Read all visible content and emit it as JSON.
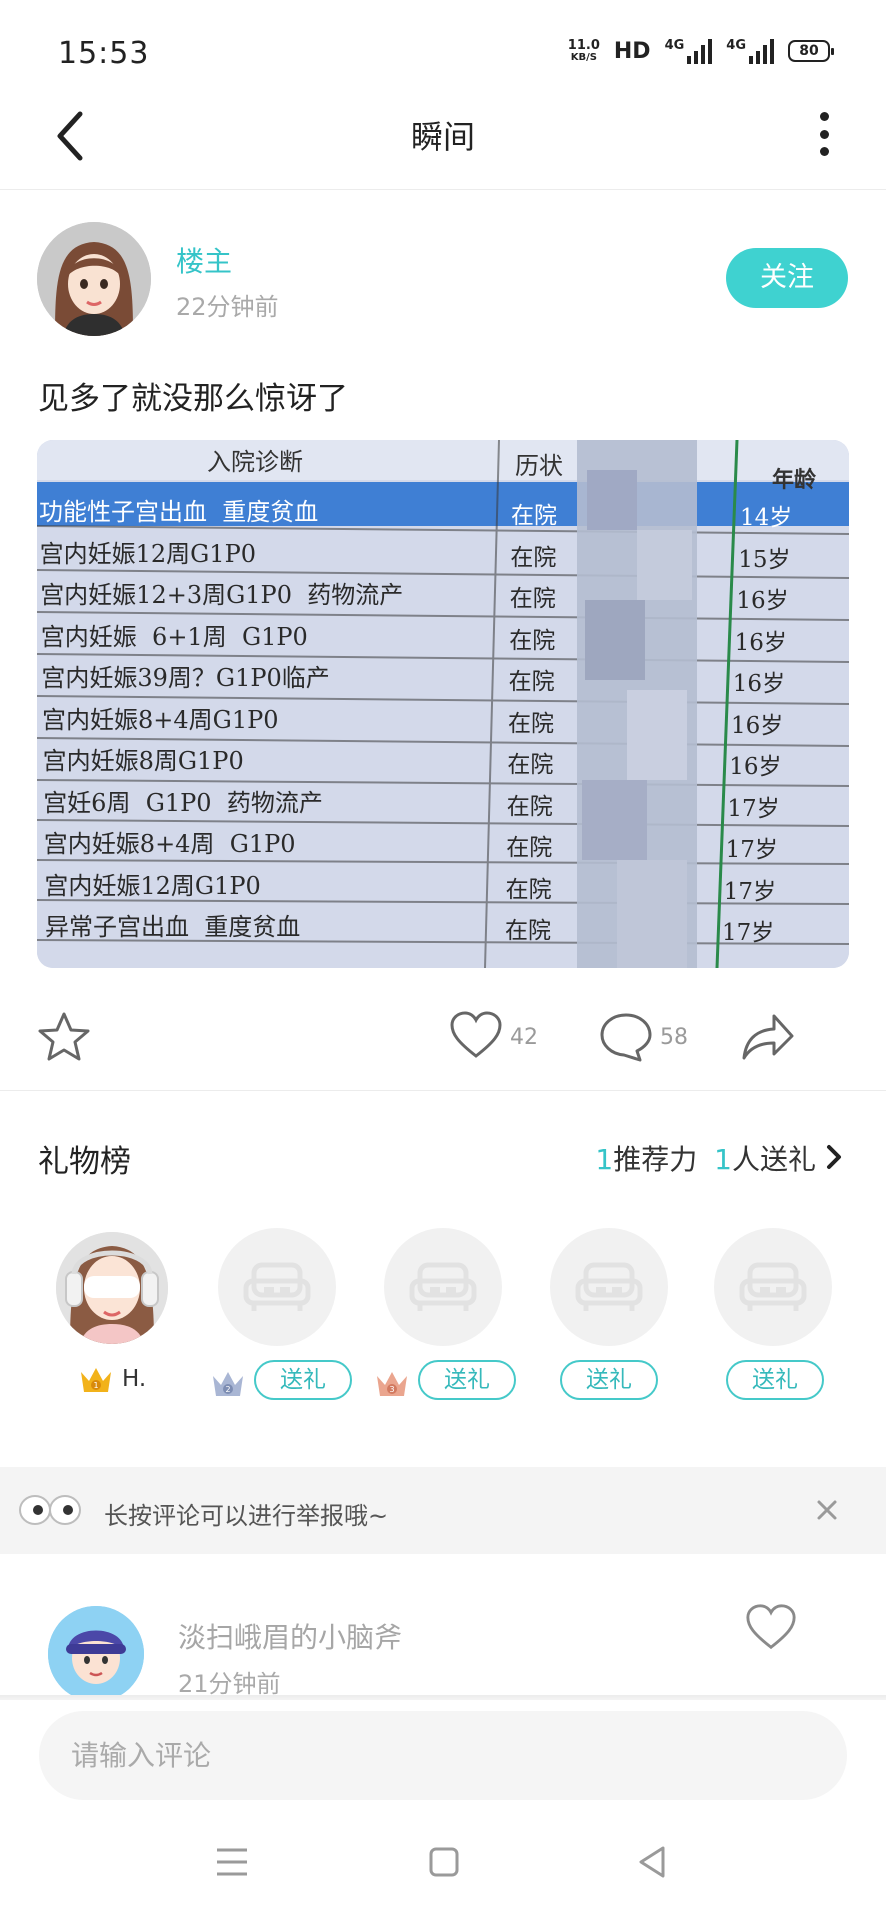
{
  "status_bar": {
    "time": "15:53",
    "speed_value": "11.0",
    "speed_unit": "KB/S",
    "hd_label": "HD",
    "sim1_label": "4G",
    "sim2_label": "4G",
    "battery": "80"
  },
  "header": {
    "title": "瞬间",
    "back_icon": "chevron-left-icon",
    "more_icon": "more-vertical-icon"
  },
  "post": {
    "author_name": "楼主",
    "post_time": "22分钟前",
    "follow_label": "关注",
    "text": "见多了就没那么惊讶了",
    "photo": {
      "headers": [
        "入院诊断",
        "历状",
        "年龄"
      ],
      "rows": [
        {
          "diagnosis": "功能性子宫出血  重度贫血",
          "status": "在院",
          "age": "14岁"
        },
        {
          "diagnosis": "宫内妊娠12周G1P0",
          "status": "在院",
          "age": "15岁"
        },
        {
          "diagnosis": "宫内妊娠12+3周G1P0  药物流产",
          "status": "在院",
          "age": "16岁"
        },
        {
          "diagnosis": "宫内妊娠  6+1周  G1P0",
          "status": "在院",
          "age": "16岁"
        },
        {
          "diagnosis": "宫内妊娠39周？G1P0临产",
          "status": "在院",
          "age": "16岁"
        },
        {
          "diagnosis": "宫内妊娠8+4周G1P0",
          "status": "在院",
          "age": "16岁"
        },
        {
          "diagnosis": "宫内妊娠8周G1P0",
          "status": "在院",
          "age": "16岁"
        },
        {
          "diagnosis": "宫妊6周  G1P0  药物流产",
          "status": "在院",
          "age": "17岁"
        },
        {
          "diagnosis": "宫内妊娠8+4周  G1P0",
          "status": "在院",
          "age": "17岁"
        },
        {
          "diagnosis": "宫内妊娠12周G1P0",
          "status": "在院",
          "age": "17岁"
        },
        {
          "diagnosis": "异常子宫出血  重度贫血",
          "status": "在院",
          "age": "17岁"
        }
      ]
    },
    "actions": {
      "favorite_icon": "star-icon",
      "like_icon": "heart-icon",
      "like_count": "42",
      "comment_icon": "comment-bubble-icon",
      "comment_count": "58",
      "share_icon": "share-arrow-icon"
    }
  },
  "gift_list": {
    "title": "礼物榜",
    "recommend_count": "1",
    "recommend_label": "推荐力",
    "sender_count": "1",
    "sender_label": "人送礼",
    "first_name": "H.",
    "slots": [
      {
        "rank": "1",
        "button": ""
      },
      {
        "rank": "2",
        "button": "送礼"
      },
      {
        "rank": "3",
        "button": "送礼"
      },
      {
        "rank": "",
        "button": "送礼"
      },
      {
        "rank": "",
        "button": "送礼"
      }
    ],
    "crown_colors": {
      "gold": "#f2b21a",
      "silver": "#a9b6d4",
      "bronze": "#eaa58e"
    }
  },
  "tip": {
    "text": "长按评论可以进行举报哦~",
    "icon": "eyes-icon",
    "close_icon": "close-icon"
  },
  "comment": {
    "name": "淡扫峨眉的小脑斧",
    "time": "21分钟前",
    "like_icon": "heart-icon"
  },
  "input": {
    "placeholder": "请输入评论"
  },
  "nav_bar": {
    "menu_icon": "menu-icon",
    "home_icon": "square-home-icon",
    "back_icon": "triangle-back-icon"
  },
  "colors": {
    "accent": "#35c4c8",
    "follow_bg": "#3fd2d0",
    "muted_text": "#a9a9a9"
  }
}
